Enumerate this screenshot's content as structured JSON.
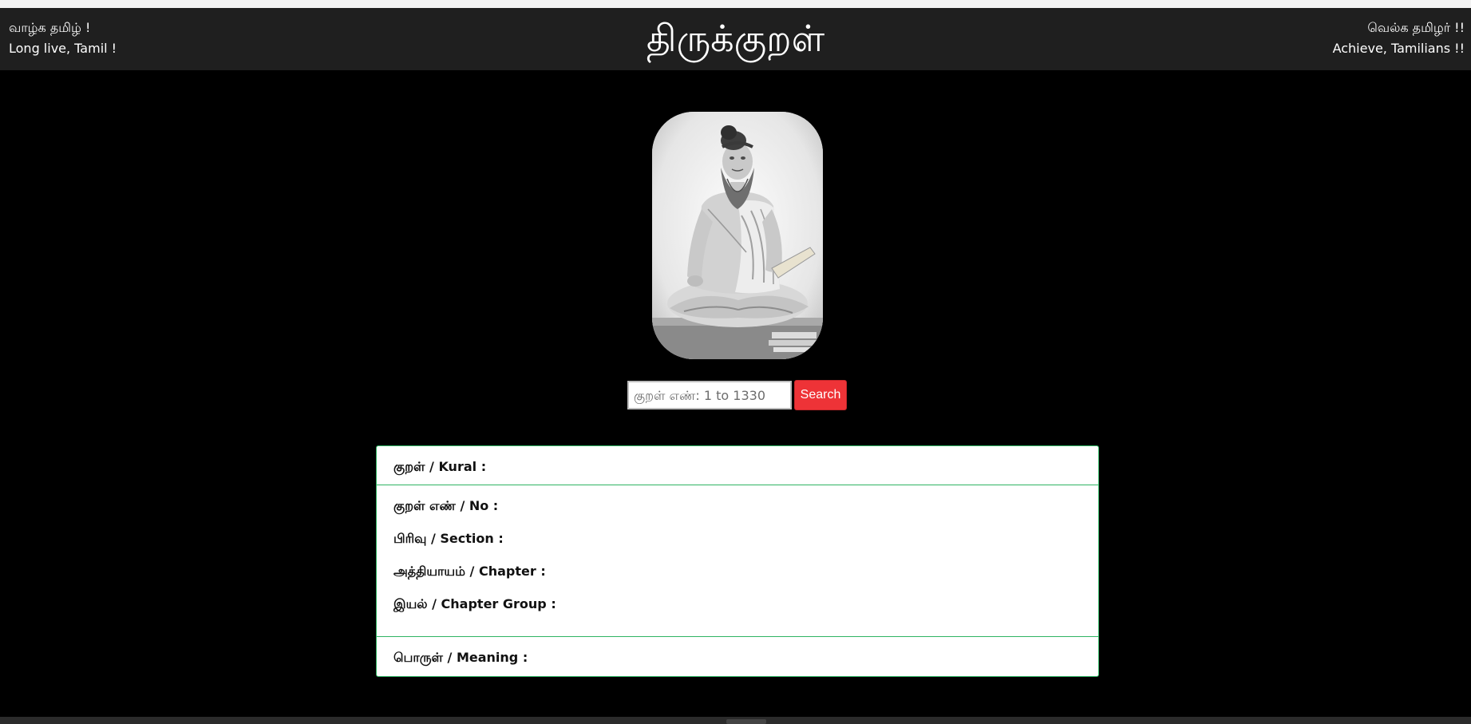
{
  "header": {
    "left_line1": "வாழ்க தமிழ் !",
    "left_line2": "Long live, Tamil !",
    "title": "திருக்குறள்",
    "right_line1": "வெல்க தமிழர் !!",
    "right_line2": "Achieve, Tamilians !!"
  },
  "search": {
    "placeholder": "குறள் எண்: 1 to 1330",
    "value": "",
    "button_label": "Search"
  },
  "card": {
    "kural_label": "குறள் / Kural :",
    "number_label": "குறள் எண் / No :",
    "section_label": "பிரிவு / Section :",
    "chapter_label": "அத்தியாயம் / Chapter :",
    "chapter_group_label": "இயல் / Chapter Group :",
    "meaning_label": "பொருள் / Meaning :"
  },
  "colors": {
    "page_bg": "#000000",
    "header_bg": "#1f1f1f",
    "accent_red": "#ee3337",
    "card_border_green": "#2fb463"
  },
  "icons": {
    "portrait": "thiruvalluvar-portrait"
  }
}
